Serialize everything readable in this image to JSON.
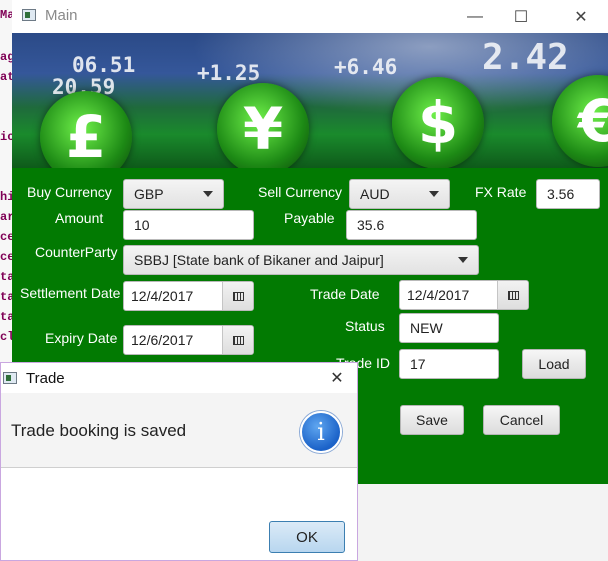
{
  "background_ide": {
    "fragments": [
      "Ma",
      "ag",
      "at",
      "ic",
      "hi",
      "ar",
      "ce",
      "ce",
      "ta",
      "ta",
      "ta",
      "cl"
    ]
  },
  "window": {
    "title": "Main",
    "minimize_glyph": "—",
    "maximize_glyph": "☐",
    "close_glyph": "✕"
  },
  "banner": {
    "tickers": [
      "+1.25",
      "20.59",
      "+6.46",
      "2.42",
      "06.51"
    ],
    "coins": [
      "£",
      "¥",
      "$",
      "€"
    ]
  },
  "form": {
    "buy_currency": {
      "label": "Buy Currency",
      "value": "GBP"
    },
    "sell_currency": {
      "label": "Sell Currency",
      "value": "AUD"
    },
    "fx_rate": {
      "label": "FX Rate",
      "value": "3.56"
    },
    "amount": {
      "label": "Amount",
      "value": "10"
    },
    "payable": {
      "label": "Payable",
      "value": "35.6"
    },
    "counterparty": {
      "label": "CounterParty",
      "value": "SBBJ [State bank of Bikaner and Jaipur]"
    },
    "settlement_date": {
      "label": "Settlement Date",
      "value": "12/4/2017"
    },
    "trade_date": {
      "label": "Trade Date",
      "value": "12/4/2017"
    },
    "expiry_date": {
      "label": "Expiry Date",
      "value": "12/6/2017"
    },
    "status": {
      "label": "Status",
      "value": "NEW"
    },
    "trade_id": {
      "label": "Trade ID",
      "value": "17"
    },
    "load_label": "Load",
    "save_label": "Save",
    "cancel_label": "Cancel"
  },
  "dialog": {
    "title": "Trade",
    "close_glyph": "✕",
    "message": "Trade booking is saved",
    "info_glyph": "i",
    "ok_label": "OK"
  },
  "colors": {
    "form_green": "#027a02",
    "dialog_border": "#c9a7e0"
  }
}
